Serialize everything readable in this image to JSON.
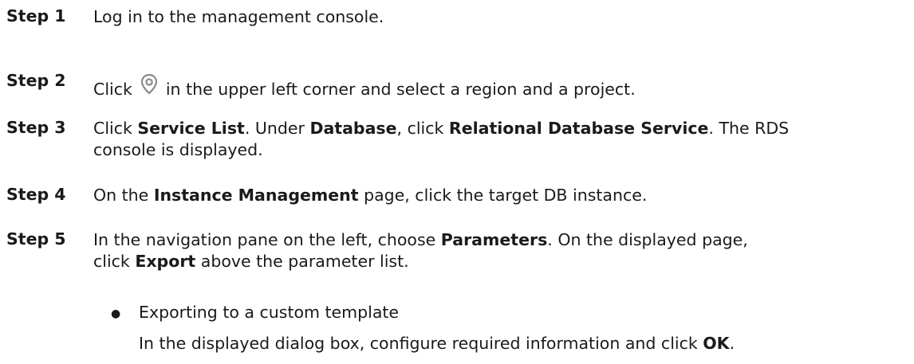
{
  "steps": [
    {
      "label": "Step 1",
      "text": "Log in to the management console."
    },
    {
      "label": "Step 2",
      "before_icon": "Click",
      "icon": "location-pin-icon",
      "after_icon": "in the upper left corner and select a region and a project."
    },
    {
      "label": "Step 3",
      "t1": "Click ",
      "b1": "Service List",
      "t2": ". Under ",
      "b2": "Database",
      "t3": ", click ",
      "b3": "Relational Database Service",
      "t4": ". The RDS",
      "line2": "console is displayed."
    },
    {
      "label": "Step 4",
      "t1": "On the ",
      "b1": "Instance Management",
      "t2": " page, click the target DB instance."
    },
    {
      "label": "Step 5",
      "t1": "In the navigation pane on the left, choose ",
      "b1": "Parameters",
      "t2": ". On the displayed page,",
      "t3": "click ",
      "b2": "Export",
      "t4": " above the parameter list.",
      "bullet": "●",
      "bullet_title": "Exporting to a custom template",
      "bullet_t1": "In the displayed dialog box, configure required information and click ",
      "bullet_b1": "OK",
      "bullet_t2": "."
    }
  ]
}
